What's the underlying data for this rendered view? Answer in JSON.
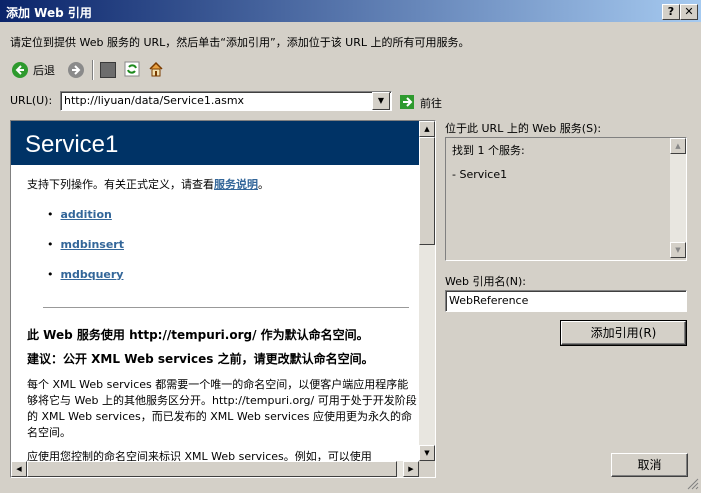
{
  "window": {
    "title": "添加 Web 引用",
    "help_label": "?",
    "close_label": "✕"
  },
  "instruction": "请定位到提供 Web 服务的 URL，然后单击“添加引用”，添加位于该 URL 上的所有可用服务。",
  "toolbar": {
    "back_label": "后退"
  },
  "url": {
    "label": "URL(U):",
    "value": "http://liyuan/data/Service1.asmx",
    "go_label": "前往"
  },
  "browser": {
    "service_title": "Service1",
    "intro_text": "支持下列操作。有关正式定义，请查看",
    "intro_link": "服务说明",
    "intro_end": "。",
    "operations": [
      "addition",
      "mdbinsert",
      "mdbquery"
    ],
    "namespace_line": "此 Web 服务使用 http://tempuri.org/ 作为默认命名空间。",
    "advice_line": "建议：公开 XML Web services 之前，请更改默认命名空间。",
    "para1": "每个 XML Web services 都需要一个唯一的命名空间，以便客户端应用程序能够将它与 Web 上的其他服务区分开。http://tempuri.org/ 可用于处于开发阶段的 XML Web services，而已发布的 XML Web services 应使用更为永久的命名空间。",
    "para2": "应使用您控制的命名空间来标识 XML Web services。例如，可以使用"
  },
  "services_panel": {
    "label": "位于此 URL 上的 Web 服务(S):",
    "found_text": "找到 1 个服务:",
    "service_item": "- Service1"
  },
  "reference": {
    "label": "Web 引用名(N):",
    "value": "WebReference"
  },
  "buttons": {
    "add_reference": "添加引用(R)",
    "cancel": "取消"
  }
}
